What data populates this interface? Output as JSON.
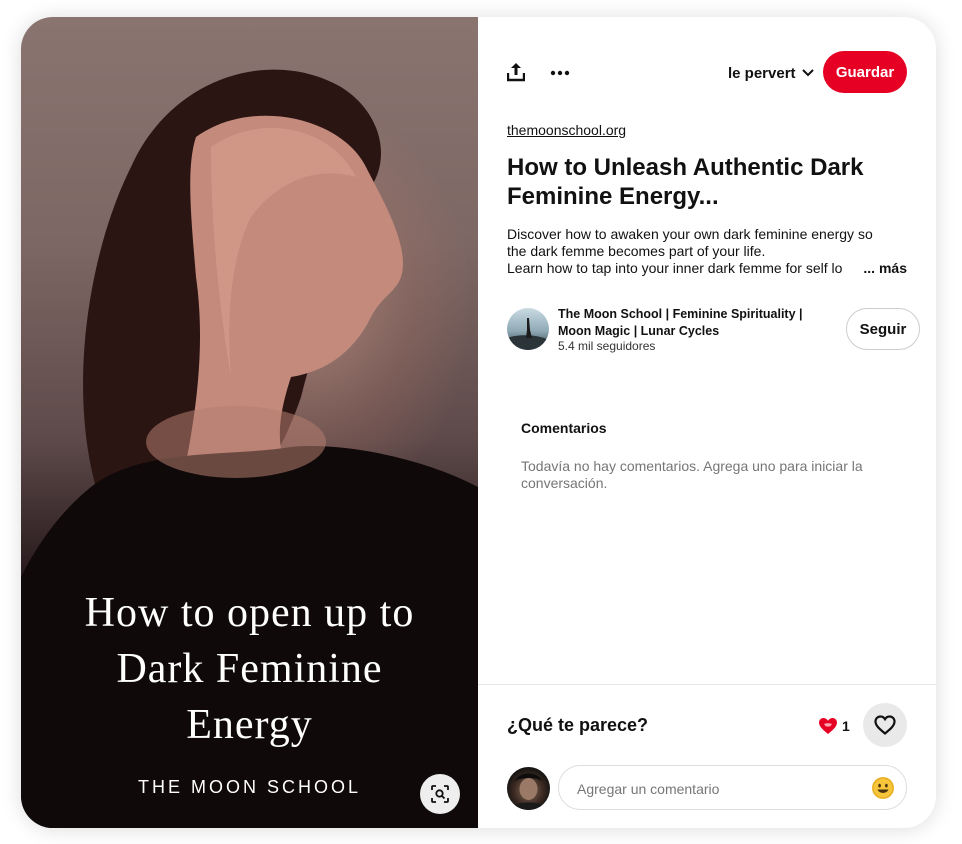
{
  "pin_image": {
    "title_lines": [
      "How to open up to",
      "Dark Feminine",
      "Energy"
    ],
    "brand": "THE MOON SCHOOL"
  },
  "toolbar": {
    "board_name": "le pervert",
    "save_label": "Guardar"
  },
  "pin": {
    "source": "themoonschool.org",
    "title_lines": [
      "How to Unleash Authentic Dark",
      "Feminine Energy..."
    ],
    "description_lines": [
      "Discover how to awaken your own dark feminine energy so",
      "the dark femme becomes part of your life.",
      "Learn how to tap into your inner dark femme for self lo"
    ],
    "more_label": "... más"
  },
  "creator": {
    "name": "The Moon School | Feminine Spirituality | Moon Magic | Lunar Cycles",
    "followers": "5.4 mil seguidores",
    "follow_label": "Seguir"
  },
  "comments": {
    "title": "Comentarios",
    "empty_text": "Todavía no hay comentarios. Agrega uno para iniciar la conversación."
  },
  "footer": {
    "prompt": "¿Qué te parece?",
    "reaction_count": "1",
    "comment_placeholder": "Agregar un comentario"
  },
  "icons": {
    "share": "share-icon",
    "more": "more-options-icon",
    "chevron": "chevron-down-icon",
    "lens": "visual-search-icon",
    "reaction": "heart-reaction-icon",
    "react": "heart-outline-icon",
    "emoji": "emoji-icon"
  },
  "colors": {
    "save_button": "#e60023",
    "reaction_heart": "#e60023"
  }
}
